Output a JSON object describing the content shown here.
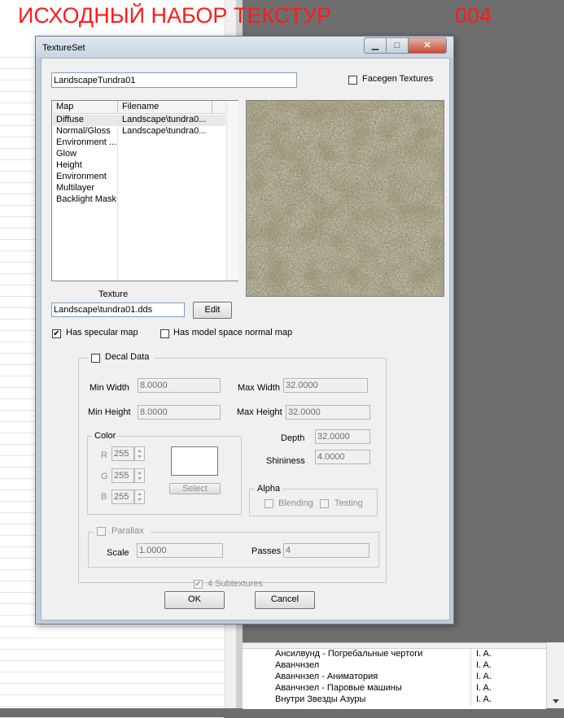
{
  "heading": {
    "title": "ИСХОДНЫЙ НАБОР ТЕКСТУР",
    "number": "004"
  },
  "bottom_list": {
    "rows": [
      {
        "name": "Ансилвунд - Погребальные чертоги",
        "col": "I.  A."
      },
      {
        "name": "Аванчнзел",
        "col": "I.  A."
      },
      {
        "name": "Аванчнзел - Аниматория",
        "col": "I.  A."
      },
      {
        "name": "Аванчнзел - Паровые машины",
        "col": "I.  A."
      },
      {
        "name": "Внутри Звезды Азуры",
        "col": "I.  A."
      }
    ]
  },
  "dialog": {
    "title": "TextureSet",
    "window_buttons": {
      "minimize": "▁",
      "maximize": "□",
      "close": "✕"
    },
    "editor_id": "LandscapeTundra01",
    "facegen_label": "Facegen Textures",
    "facegen_checked": false,
    "map_list": {
      "headers": [
        "Map",
        "Filename"
      ],
      "rows": [
        {
          "map": "Diffuse",
          "file": "Landscape\\tundra0..."
        },
        {
          "map": "Normal/Gloss",
          "file": "Landscape\\tundra0..."
        },
        {
          "map": "Environment ...",
          "file": ""
        },
        {
          "map": "Glow",
          "file": ""
        },
        {
          "map": "Height",
          "file": ""
        },
        {
          "map": "Environment",
          "file": ""
        },
        {
          "map": "Multilayer",
          "file": ""
        },
        {
          "map": "Backlight Mask",
          "file": ""
        }
      ]
    },
    "texture_label": "Texture",
    "texture_path": "Landscape\\tundra01.dds",
    "edit_button": "Edit",
    "has_specular_label": "Has specular map",
    "has_specular_checked": true,
    "model_space_label": "Has model space normal map",
    "model_space_checked": false,
    "decal": {
      "label": "Decal Data",
      "checked": false,
      "min_width_label": "Min Width",
      "min_width": "8.0000",
      "max_width_label": "Max Width",
      "max_width": "32.0000",
      "min_height_label": "Min Height",
      "min_height": "8.0000",
      "max_height_label": "Max Height",
      "max_height": "32.0000",
      "color_label": "Color",
      "r_label": "R",
      "r": "255",
      "g_label": "G",
      "g": "255",
      "b_label": "B",
      "b": "255",
      "select_button": "Select",
      "depth_label": "Depth",
      "depth": "32.0000",
      "shininess_label": "Shininess",
      "shininess": "4.0000",
      "alpha_label": "Alpha",
      "blending_label": "Blending",
      "testing_label": "Testing",
      "parallax_label": "Parallax",
      "scale_label": "Scale",
      "scale": "1.0000",
      "passes_label": "Passes",
      "passes": "4",
      "subtextures_label": "4 Subtextures",
      "subtextures_checked": true
    },
    "ok_button": "OK",
    "cancel_button": "Cancel"
  }
}
